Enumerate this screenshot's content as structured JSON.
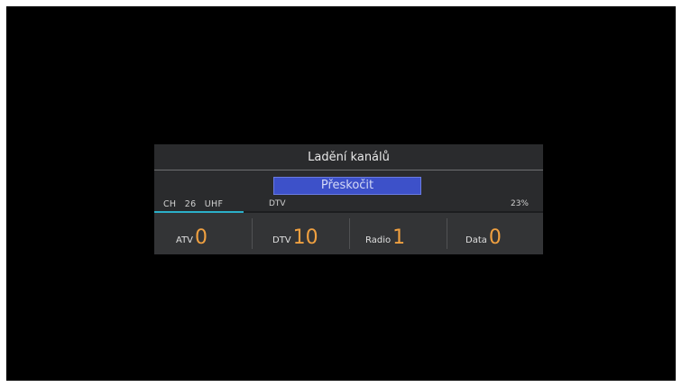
{
  "dialog": {
    "title": "Ladění kanálů",
    "skip_button": "Přeskočit"
  },
  "scan": {
    "channel_prefix": "CH",
    "channel_number": "26",
    "band": "UHF",
    "type": "DTV",
    "progress_text": "23%",
    "progress_fraction": 0.23
  },
  "stats": [
    {
      "label": "ATV",
      "value": "0"
    },
    {
      "label": "DTV",
      "value": "10"
    },
    {
      "label": "Radio",
      "value": "1"
    },
    {
      "label": "Data",
      "value": "0"
    }
  ],
  "colors": {
    "screen_bg": "#000000",
    "dialog_bg": "#2a2b2d",
    "accent_button": "#3d51c9",
    "progress": "#2bb0c9",
    "stat_value": "#f0a040"
  }
}
